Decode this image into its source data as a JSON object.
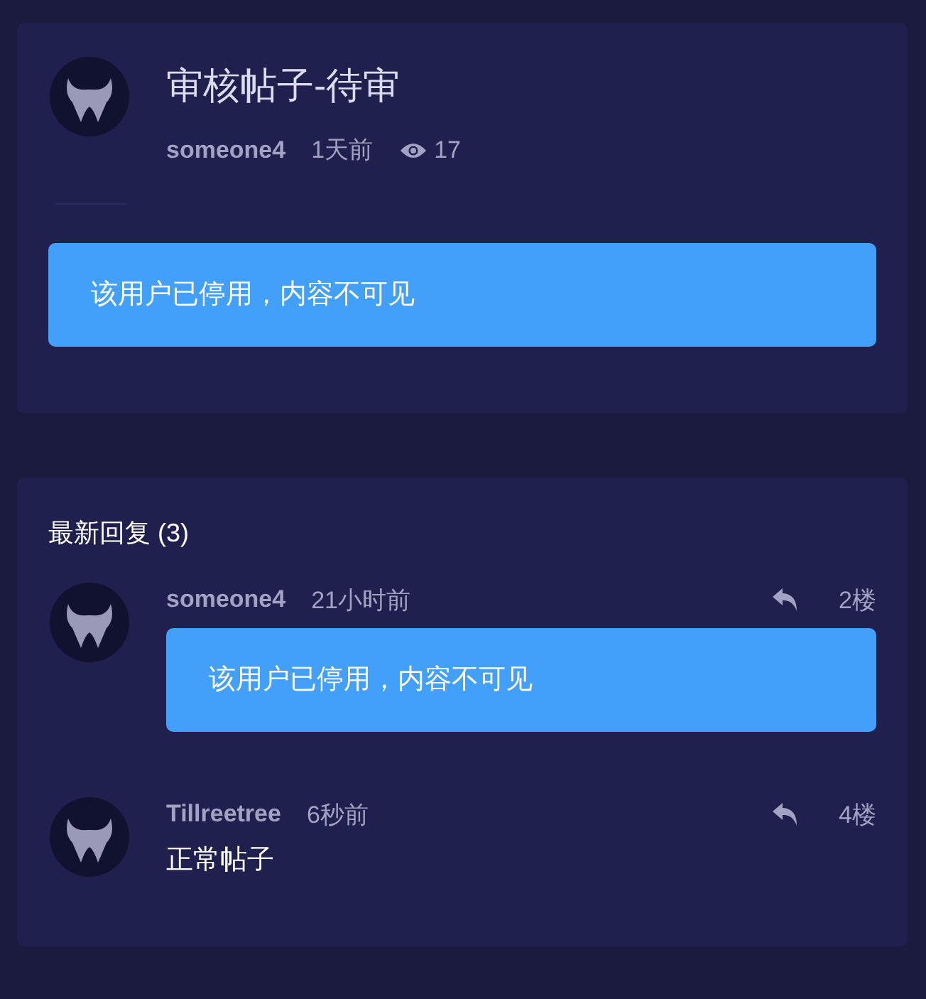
{
  "post": {
    "title": "审核帖子-待审",
    "author": "someone4",
    "time": "1天前",
    "views": "17",
    "content": {
      "kind": "blocked",
      "text": "该用户已停用，内容不可见"
    }
  },
  "replies_section": {
    "heading": "最新回复 (3)",
    "replies": [
      {
        "author": "someone4",
        "time": "21小时前",
        "floor": "2楼",
        "kind": "blocked",
        "text": "该用户已停用，内容不可见"
      },
      {
        "author": "Tillreetree",
        "time": "6秒前",
        "floor": "4楼",
        "kind": "normal",
        "text": "正常帖子"
      }
    ]
  }
}
